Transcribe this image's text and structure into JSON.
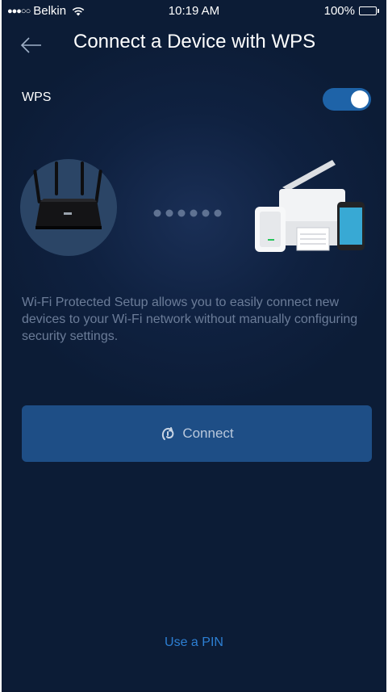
{
  "status_bar": {
    "carrier": "Belkin",
    "signal_dots": "●●●○○",
    "time": "10:19 AM",
    "battery": "100%"
  },
  "header": {
    "title": "Connect a Device with WPS",
    "back_icon": "arrow-left-icon"
  },
  "wps": {
    "label": "WPS",
    "enabled": true
  },
  "illustration": {
    "router_icon": "router-icon",
    "devices_icon": "devices-icon"
  },
  "description": "Wi-Fi Protected Setup allows you to easily connect new devices to your Wi-Fi network without manually configuring security settings.",
  "connect_button": {
    "label": "Connect",
    "icon": "wps-icon"
  },
  "pin_link": "Use a PIN",
  "colors": {
    "background": "#0f2140",
    "toggle_on": "#1e63a8",
    "button": "#1e4e86",
    "link": "#2d7fd3"
  }
}
